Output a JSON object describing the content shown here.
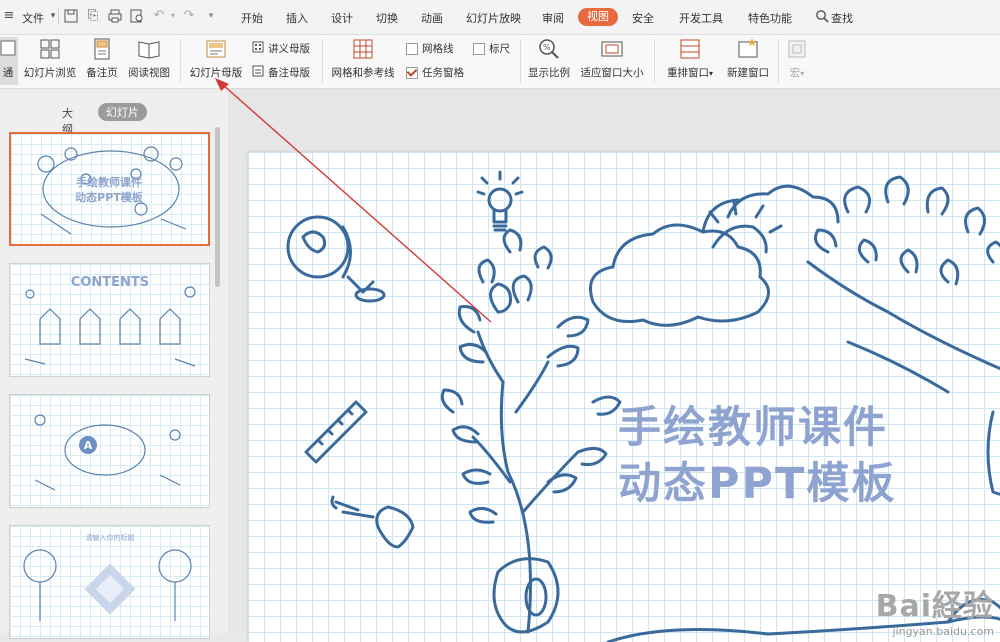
{
  "menubar": {
    "file_label": "文件",
    "tabs": [
      "开始",
      "插入",
      "设计",
      "切换",
      "动画",
      "幻灯片放映",
      "审阅",
      "视图",
      "安全",
      "开发工具",
      "特色功能"
    ],
    "search_label": "查找"
  },
  "ribbon": {
    "normal_label": "通",
    "slide_browse": "幻灯片浏览",
    "notes_page": "备注页",
    "reading_view": "阅读视图",
    "slide_master": "幻灯片母版",
    "handout_master": "讲义母版",
    "notes_master": "备注母版",
    "grid_guides": "网格和参考线",
    "gridlines": "网格线",
    "ruler": "标尺",
    "task_pane": "任务窗格",
    "zoom": "显示比例",
    "fit_window": "适应窗口大小",
    "arrange_window": "重排窗口",
    "new_window": "新建窗口",
    "macro": "宏",
    "gridlines_checked": false,
    "ruler_checked": false,
    "task_pane_checked": true
  },
  "sidebar": {
    "outline_tab": "大纲",
    "slides_tab": "幻灯片",
    "thumbs": [
      {
        "title": "手绘教师课件\n动态PPT模板"
      },
      {
        "title": "CONTENTS"
      },
      {
        "title": "A"
      },
      {
        "title": "请输入你的标题"
      }
    ]
  },
  "slide": {
    "title_line1": "手绘教师课件",
    "title_line2": "动态PPT模板"
  },
  "watermark": {
    "main": "Bai経验",
    "sub": "jingyan.baidu.com"
  },
  "colors": {
    "accent": "#e8693e",
    "sketch": "#3a6a9c",
    "title": "#8ea3cf",
    "annotation_arrow": "#d23a3a"
  }
}
